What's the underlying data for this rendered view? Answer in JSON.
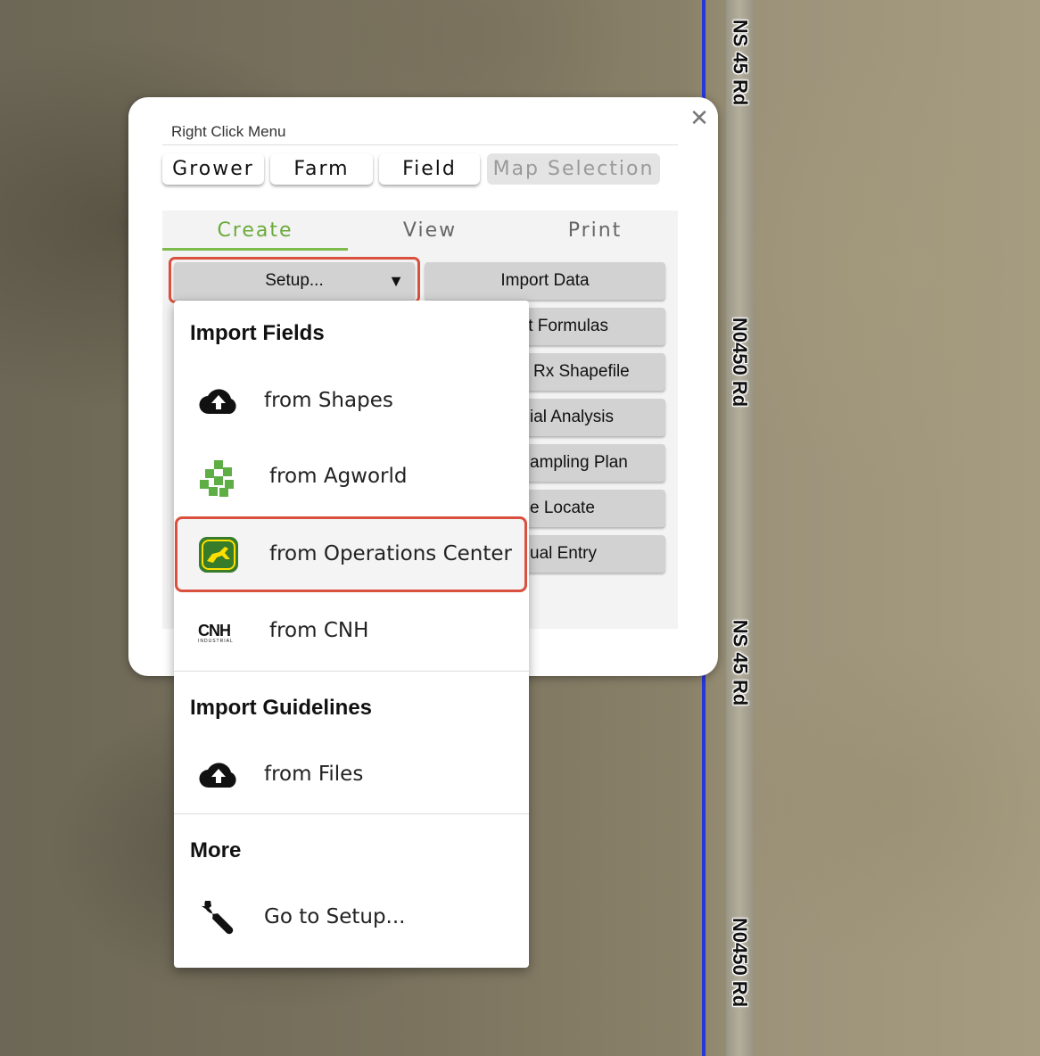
{
  "map": {
    "road_labels": [
      "NS 45 Rd",
      "N0450 Rd",
      "NS 45 Rd",
      "N0450 Rd"
    ]
  },
  "panel": {
    "title": "Right Click Menu",
    "close_icon": "close-icon",
    "top_tabs": [
      "Grower",
      "Farm",
      "Field",
      "Map Selection"
    ],
    "sub_tabs": [
      "Create",
      "View",
      "Print"
    ],
    "active_sub_tab": "Create",
    "setup_button": "Setup...",
    "setup_arrow": "▼",
    "import_data_button": "Import Data",
    "partial_buttons": [
      "it Formulas",
      "Rx Shapefile",
      "ial Analysis",
      "ampling Plan",
      "e Locate",
      "ual Entry"
    ]
  },
  "dropdown": {
    "sections": [
      {
        "heading": "Import Fields",
        "items": [
          {
            "label": "from Shapes",
            "icon": "cloud-upload-icon"
          },
          {
            "label": "from Agworld",
            "icon": "agworld-logo-icon"
          },
          {
            "label": "from Operations Center",
            "icon": "john-deere-logo-icon",
            "highlighted": true
          },
          {
            "label": "from CNH",
            "icon": "cnh-industrial-logo-icon"
          }
        ]
      },
      {
        "heading": "Import Guidelines",
        "items": [
          {
            "label": "from Files",
            "icon": "cloud-upload-icon"
          }
        ]
      },
      {
        "heading": "More",
        "items": [
          {
            "label": "Go to Setup...",
            "icon": "wrench-icon"
          }
        ]
      }
    ],
    "cnh_logo_text": "CNH",
    "cnh_logo_subtext": "INDUSTRIAL"
  },
  "colors": {
    "accent_green": "#7cbb4c",
    "highlight_red": "#d9503f",
    "map_line_blue": "#2b36d6"
  }
}
